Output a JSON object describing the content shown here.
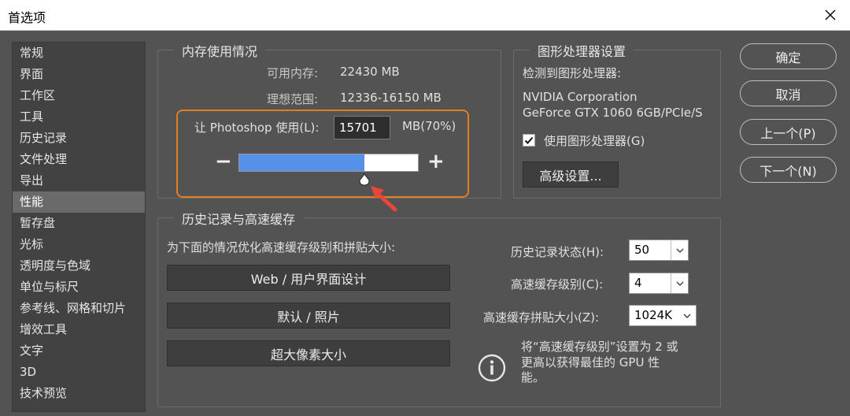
{
  "window": {
    "title": "首选项"
  },
  "sidebar": {
    "items": [
      {
        "label": "常规"
      },
      {
        "label": "界面"
      },
      {
        "label": "工作区"
      },
      {
        "label": "工具"
      },
      {
        "label": "历史记录"
      },
      {
        "label": "文件处理"
      },
      {
        "label": "导出"
      },
      {
        "label": "性能",
        "active": true
      },
      {
        "label": "暂存盘"
      },
      {
        "label": "光标"
      },
      {
        "label": "透明度与色域"
      },
      {
        "label": "单位与标尺"
      },
      {
        "label": "参考线、网格和切片"
      },
      {
        "label": "增效工具"
      },
      {
        "label": "文字"
      },
      {
        "label": "3D"
      },
      {
        "label": "技术预览"
      }
    ]
  },
  "memory": {
    "legend": "内存使用情况",
    "available_label": "可用内存:",
    "available_value": "22430 MB",
    "ideal_label": "理想范围:",
    "ideal_value": "12336-16150 MB",
    "let_label": "让 Photoshop 使用(L):",
    "let_value": "15701",
    "let_unit": "MB(70%)",
    "minus": "−",
    "plus": "+",
    "slider_percent": 70
  },
  "gpu": {
    "legend": "图形处理器设置",
    "detected_label": "检测到图形处理器:",
    "vendor": "NVIDIA Corporation",
    "model": "GeForce GTX 1060 6GB/PCIe/S",
    "use_gpu_label": "使用图形处理器(G)",
    "use_gpu_checked": true,
    "advanced_button": "高级设置..."
  },
  "buttons": {
    "ok": "确定",
    "cancel": "取消",
    "prev": "上一个(P)",
    "next": "下一个(N)"
  },
  "cache": {
    "legend": "历史记录与高速缓存",
    "optimize_label": "为下面的情况优化高速缓存级别和拼贴大小:",
    "preset_web": "Web / 用户界面设计",
    "preset_default": "默认 / 照片",
    "preset_huge": "超大像素大小",
    "history_states_label": "历史记录状态(H):",
    "history_states_value": "50",
    "cache_levels_label": "高速缓存级别(C):",
    "cache_levels_value": "4",
    "tile_size_label": "高速缓存拼贴大小(Z):",
    "tile_size_value": "1024K",
    "info_text_1": "将“高速缓存级别”设置为 2 或",
    "info_text_2": "更高以获得最佳的 GPU 性",
    "info_text_3": "能。"
  },
  "colors": {
    "background": "#535353",
    "highlight": "#e27e22",
    "slider_fill": "#5591e8",
    "annotation_arrow": "#e8463a"
  }
}
